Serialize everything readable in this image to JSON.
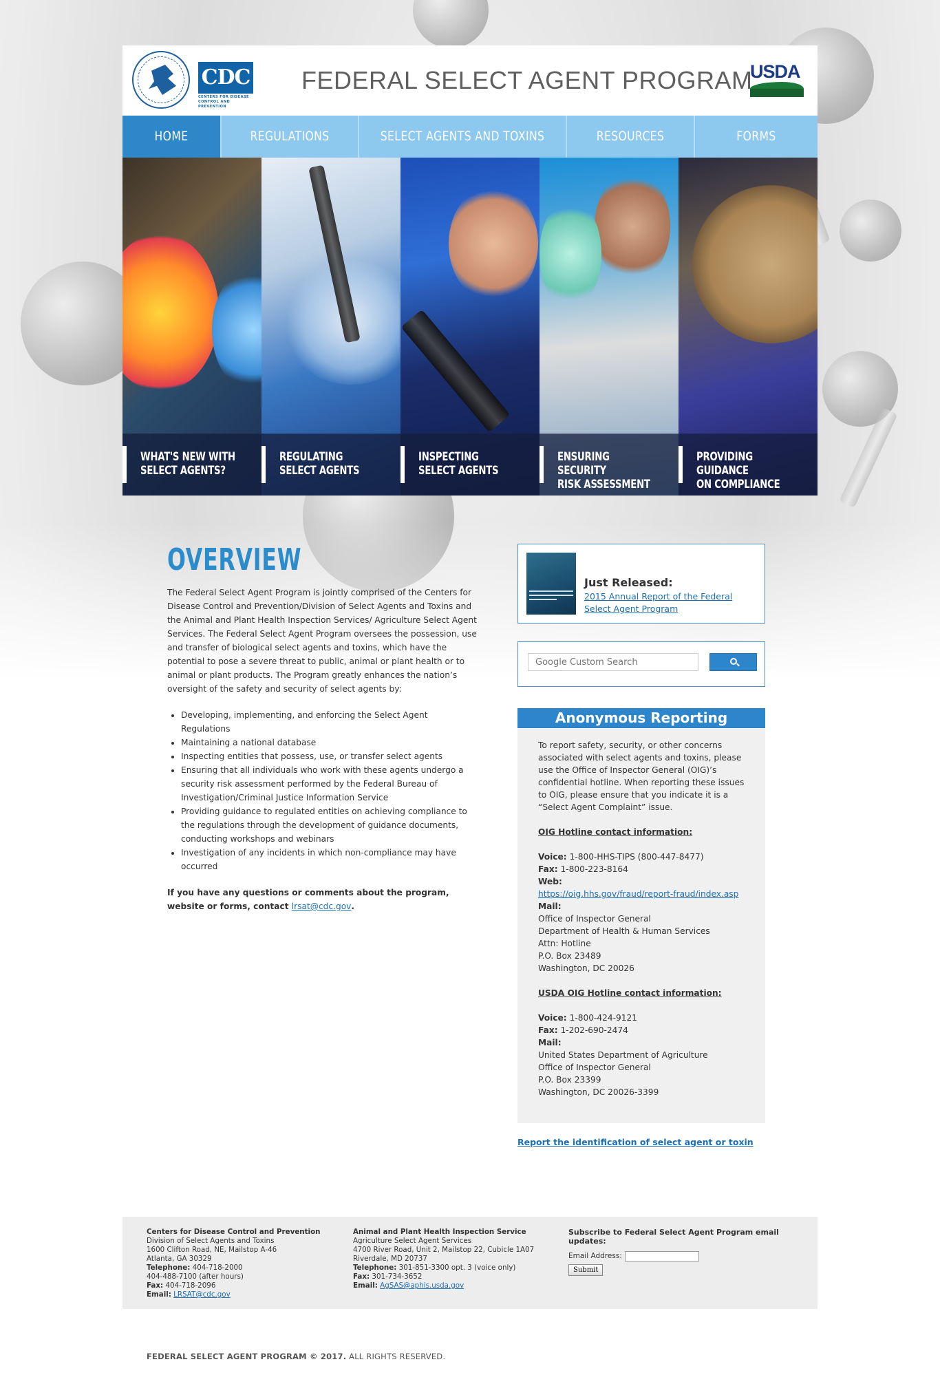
{
  "header": {
    "title": "FEDERAL SELECT AGENT PROGRAM",
    "cdc_logo_text": "CDC",
    "cdc_logo_subtext": "CENTERS FOR DISEASE CONTROL AND PREVENTION",
    "usda_logo_text": "USDA"
  },
  "nav": {
    "items": [
      {
        "label": "HOME",
        "active": true
      },
      {
        "label": "REGULATIONS",
        "active": false
      },
      {
        "label": "SELECT AGENTS AND TOXINS",
        "active": false
      },
      {
        "label": "RESOURCES",
        "active": false
      },
      {
        "label": "FORMS",
        "active": false
      }
    ]
  },
  "hero": {
    "panels": [
      {
        "caption": "WHAT'S NEW WITH\nSELECT AGENTS?"
      },
      {
        "caption": "REGULATING\nSELECT AGENTS"
      },
      {
        "caption": "INSPECTING\nSELECT AGENTS"
      },
      {
        "caption": "ENSURING SECURITY\nRISK ASSESSMENT"
      },
      {
        "caption": "PROVIDING GUIDANCE\nON COMPLIANCE"
      }
    ]
  },
  "overview": {
    "title": "OVERVIEW",
    "intro": "The Federal Select Agent Program is jointly comprised of the Centers for Disease Control and Prevention/Division of Select Agents and Toxins and the Animal and Plant Health Inspection Services/ Agriculture Select Agent Services. The Federal Select Agent Program oversees the possession, use and transfer of biological select agents and toxins, which have the potential to pose a severe threat to public, animal or plant health or to animal or plant products. The Program greatly enhances the nation’s oversight of the safety and security of select agents by:",
    "bullets": [
      "Developing, implementing, and enforcing the Select Agent Regulations",
      "Maintaining a national database",
      "Inspecting entities that possess, use, or transfer select agents",
      "Ensuring that all individuals who work with these agents undergo a security risk assessment performed by the Federal Bureau of Investigation/Criminal Justice Information Service",
      "Providing guidance to regulated entities on achieving compliance to the regulations through the development of guidance documents, conducting workshops and webinars",
      "Investigation of any incidents in which non-compliance may have occurred"
    ],
    "contact_text": "If you have any questions or comments about the program, website or forms, contact ",
    "contact_email": "lrsat@cdc.gov",
    "contact_end": "."
  },
  "release": {
    "label": "Just Released:",
    "link": "2015 Annual Report of the Federal Select Agent Program"
  },
  "search": {
    "placeholder": "Google Custom Search"
  },
  "anonymous": {
    "title": "Anonymous Reporting",
    "intro": "To report safety, security, or other concerns associated with select agents and toxins, please use the Office of Inspector General (OIG)’s confidential hotline. When reporting these issues to OIG, please ensure that you indicate it is a “Select Agent Complaint” issue.",
    "oig_heading": "OIG Hotline contact information:",
    "oig_voice_label": "Voice:",
    "oig_voice": "1-800-HHS-TIPS (800-447-8477)",
    "oig_fax_label": "Fax:",
    "oig_fax": "1-800-223-8164",
    "oig_web_label": "Web:",
    "oig_web": "https://oig.hhs.gov/fraud/report-fraud/index.asp",
    "oig_mail_label": "Mail:",
    "oig_mail_lines": [
      "Office of Inspector General",
      "Department of Health & Human Services",
      "Attn: Hotline",
      "P.O. Box 23489",
      "Washington, DC 20026"
    ],
    "usda_heading": "USDA OIG Hotline contact information:",
    "usda_voice_label": "Voice:",
    "usda_voice": "1-800-424-9121",
    "usda_fax_label": "Fax:",
    "usda_fax": "1-202-690-2474",
    "usda_mail_label": "Mail:",
    "usda_mail_lines": [
      "United States Department of Agriculture",
      "Office of Inspector General",
      "P.O. Box 23399",
      "Washington, DC 20026-3399"
    ]
  },
  "report_link": "Report the identification of select agent or toxin",
  "footer": {
    "cdc": {
      "name": "Centers for Disease Control and Prevention",
      "lines": [
        "Division of Select Agents and Toxins",
        "1600 Clifton Road, NE, Mailstop A-46",
        "Atlanta, GA 30329"
      ],
      "telephone_label": "Telephone:",
      "telephone": "404-718-2000",
      "after_hours": "404-488-7100 (after hours)",
      "fax_label": "Fax:",
      "fax": "404-718-2096",
      "email_label": "Email:",
      "email": "LRSAT@cdc.gov"
    },
    "aphis": {
      "name": "Animal and Plant Health Inspection Service",
      "lines": [
        "Agriculture Select Agent Services",
        "4700 River Road, Unit 2, Mailstop 22, Cubicle 1A07",
        "Riverdale, MD 20737"
      ],
      "telephone_label": "Telephone:",
      "telephone": "301-851-3300 opt. 3 (voice only)",
      "fax_label": "Fax:",
      "fax": "301-734-3652",
      "email_label": "Email:",
      "email": "AgSAS@aphis.usda.gov"
    },
    "subscribe": {
      "title": "Subscribe to Federal Select Agent Program email updates:",
      "email_label": "Email Address:",
      "submit": "Submit"
    }
  },
  "copyright": {
    "bold": "FEDERAL SELECT AGENT PROGRAM © 2017.",
    "normal": " ALL RIGHTS RESERVED."
  }
}
